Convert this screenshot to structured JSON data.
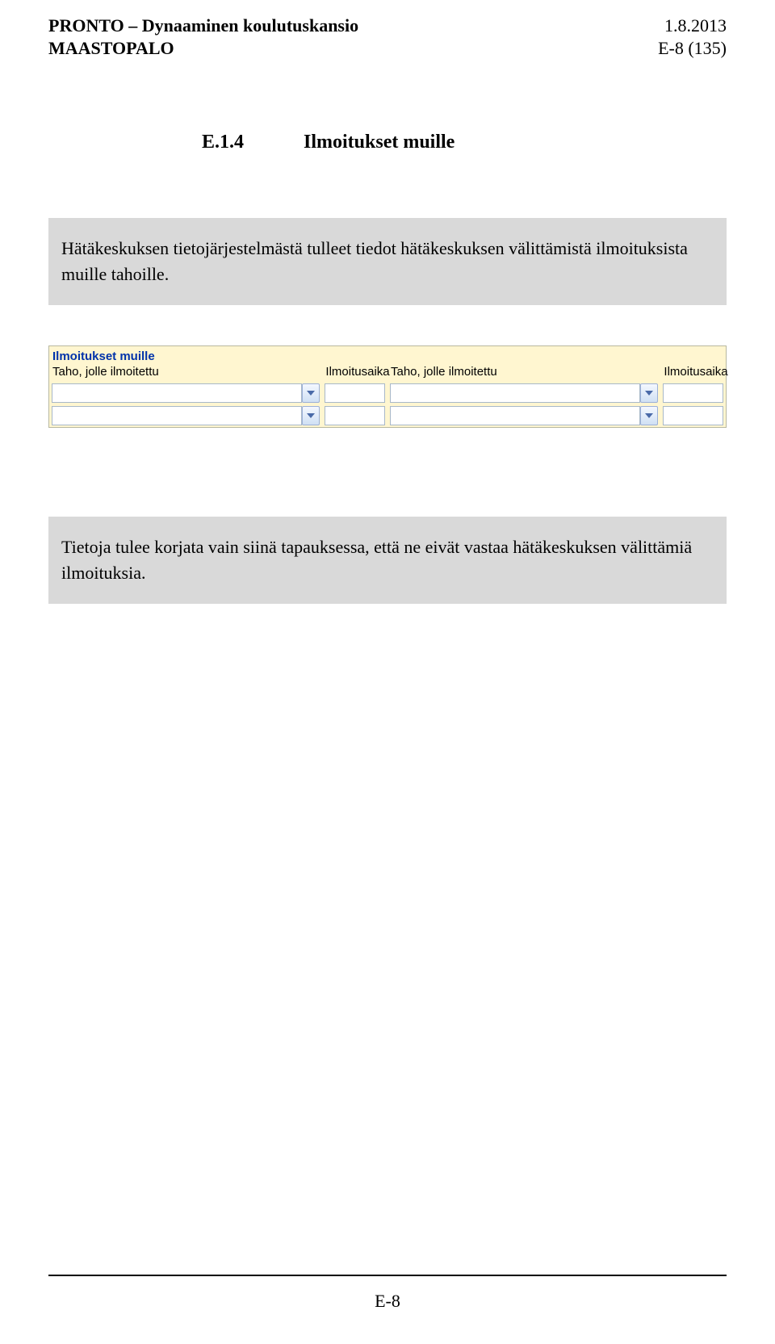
{
  "header": {
    "title_line1": "PRONTO – Dynaaminen koulutuskansio",
    "title_line2": "MAASTOPALO",
    "date": "1.8.2013",
    "page_ref": "E-8 (135)"
  },
  "section": {
    "number": "E.1.4",
    "title": "Ilmoitukset muille"
  },
  "intro_text": "Hätäkeskuksen tietojärjestelmästä tulleet tiedot hätäkeskuksen välittämistä ilmoituksista muille tahoille.",
  "form": {
    "title": "Ilmoitukset muille",
    "columns": {
      "taho1": "Taho, jolle ilmoitettu",
      "aika1": "Ilmoitusaika",
      "taho2": "Taho, jolle ilmoitettu",
      "aika2": "Ilmoitusaika"
    },
    "rows": [
      {
        "taho1": "",
        "aika1": "",
        "taho2": "",
        "aika2": ""
      },
      {
        "taho1": "",
        "aika1": "",
        "taho2": "",
        "aika2": ""
      }
    ],
    "icons": {
      "dropdown": "chevron-down"
    }
  },
  "note_text": "Tietoja tulee korjata vain siinä tapauksessa, että ne eivät vastaa hätäkeskuksen välittämiä ilmoituksia.",
  "footer": {
    "page": "E-8"
  }
}
